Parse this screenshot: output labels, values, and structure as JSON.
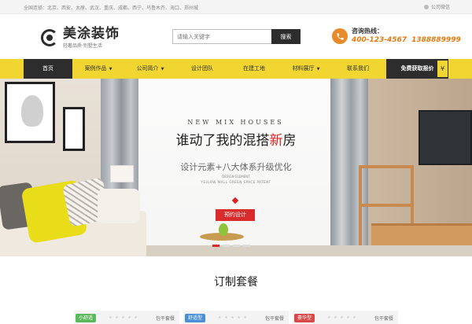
{
  "topbar": {
    "cities": "全国连锁：北京、西安、太原、武汉、重庆、成都、西宁、乌鲁木齐、海口、郑州城",
    "wechat": "公司微信"
  },
  "header": {
    "logo_name": "美涂装饰",
    "logo_slogan": "轻奢品质·别墅生活",
    "search_placeholder": "请输入关键字",
    "search_button": "搜索",
    "hotline_title": "咨询热线：",
    "hotline_1": "400-123-4567",
    "hotline_2": "1388889999"
  },
  "nav": {
    "items": [
      {
        "label": "首页"
      },
      {
        "label": "案例作品"
      },
      {
        "label": "公司简介"
      },
      {
        "label": "设计团队"
      },
      {
        "label": "在建工地"
      },
      {
        "label": "材料展厅"
      },
      {
        "label": "联系我们"
      }
    ],
    "cta": "免费获取报价",
    "tab": "¥"
  },
  "banner": {
    "headline_en": "NEW MIX HOUSES",
    "title_pre": "谁动了我的混搭",
    "title_highlight": "新",
    "title_post": "房",
    "subtitle": "设计元素+八大体系升级优化",
    "tiny_1": "DESIGN ELEMENT",
    "tiny_2": "YELLOW WALL GREEN SPACE PATENT",
    "button": "预约设计",
    "active_slide": 1,
    "slide_count": 4
  },
  "section": {
    "title": "订制套餐"
  },
  "packages": [
    {
      "tag": "小舒适",
      "tag_color": "#5cb85c",
      "stars": "★ ★ ★ ★ ★",
      "label": "包干套餐"
    },
    {
      "tag": "舒适型",
      "tag_color": "#4a8fd6",
      "stars": "★ ★ ★ ★ ★",
      "label": "包干套餐"
    },
    {
      "tag": "豪华型",
      "tag_color": "#d84848",
      "stars": "★ ★ ★ ★ ★",
      "label": "包干套餐"
    }
  ],
  "colors": {
    "nav_bg": "#f1d631",
    "dark": "#2d2d2d",
    "accent_red": "#d92b2b",
    "hotline_orange": "#e07a12"
  }
}
